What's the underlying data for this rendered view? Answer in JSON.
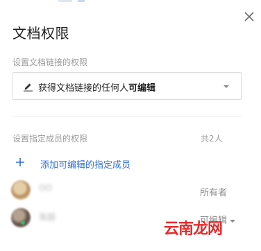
{
  "dialog": {
    "title": "文档权限",
    "close_icon": "close-icon"
  },
  "link_permission": {
    "section_label": "设置文档链接的权限",
    "icon": "edit-pencil-icon",
    "selected_prefix": "获得文档链接的任何人",
    "selected_bold": "可编辑"
  },
  "members": {
    "section_label": "设置指定成员的权限",
    "count": "共2人",
    "add_icon": "plus-icon",
    "add_label": "添加可编辑的指定成员",
    "list": [
      {
        "name": "OO",
        "role": "所有者"
      },
      {
        "name": "张超",
        "role": "可编辑"
      }
    ]
  },
  "watermark": "云南龙网",
  "colors": {
    "accent": "#2f6fd6",
    "muted": "#9b9b9b",
    "watermark": "#e52b2b"
  }
}
